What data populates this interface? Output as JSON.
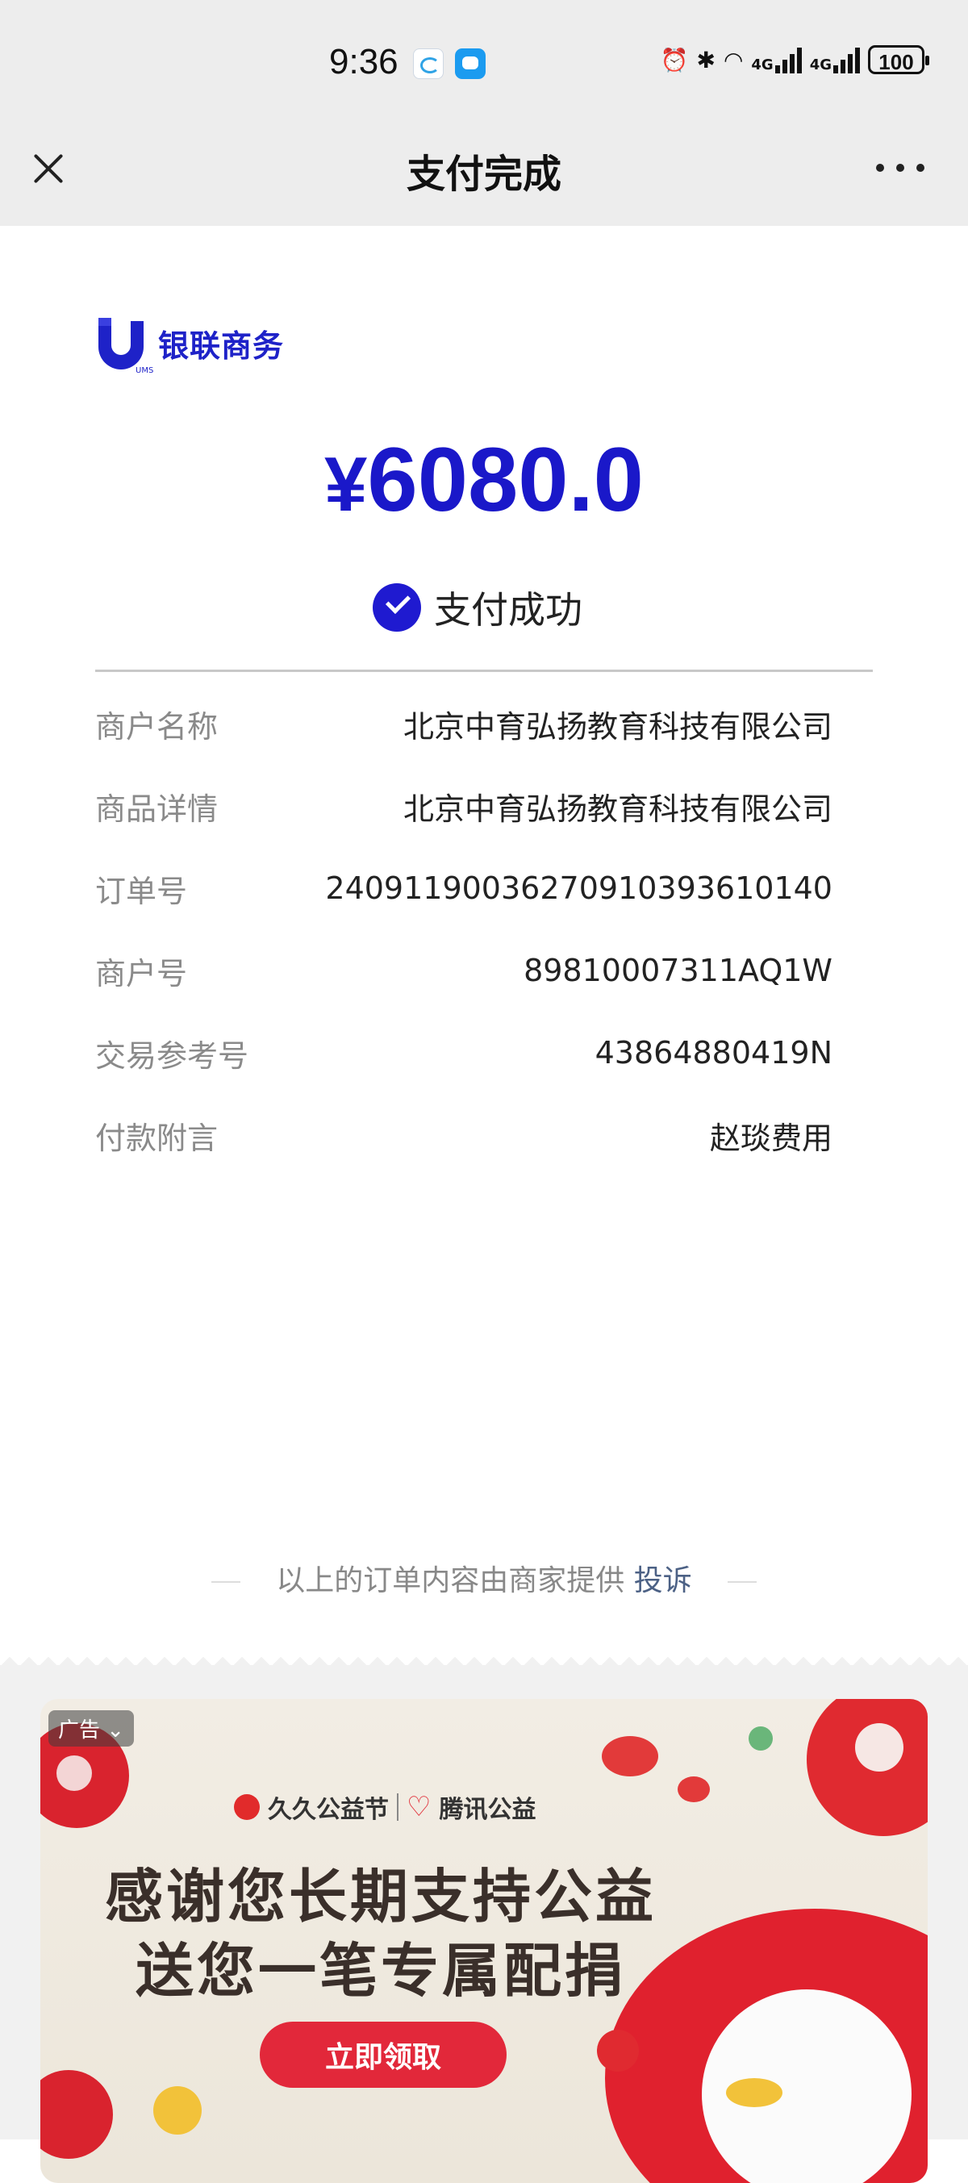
{
  "status_bar": {
    "time": "9:36",
    "network1": "4G",
    "network2": "4G",
    "battery": "100"
  },
  "header": {
    "title": "支付完成"
  },
  "merchant_logo": {
    "text": "银联商务",
    "sub": "UMS"
  },
  "payment": {
    "currency_symbol": "¥",
    "amount": "6080.0",
    "status": "支付成功"
  },
  "details": [
    {
      "label": "商户名称",
      "value": "北京中育弘扬教育科技有限公司"
    },
    {
      "label": "商品详情",
      "value": "北京中育弘扬教育科技有限公司"
    },
    {
      "label": "订单号",
      "value": "24091190036270910393610140"
    },
    {
      "label": "商户号",
      "value": "89810007311AQ1W"
    },
    {
      "label": "交易参考号",
      "value": "43864880419N"
    },
    {
      "label": "付款附言",
      "value": "赵琰费用"
    }
  ],
  "footer": {
    "note": "以上的订单内容由商家提供",
    "complain": "投诉"
  },
  "ad": {
    "tag": "广告",
    "brand1": "久久公益节",
    "brand2": "腾讯公益",
    "headline1": "感谢您长期支持公益",
    "headline2": "送您一笔专属配捐",
    "button": "立即领取"
  },
  "colors": {
    "accent": "#1a18c9",
    "title_bar_bg": "#ededed",
    "ad_button": "#e2283a"
  }
}
